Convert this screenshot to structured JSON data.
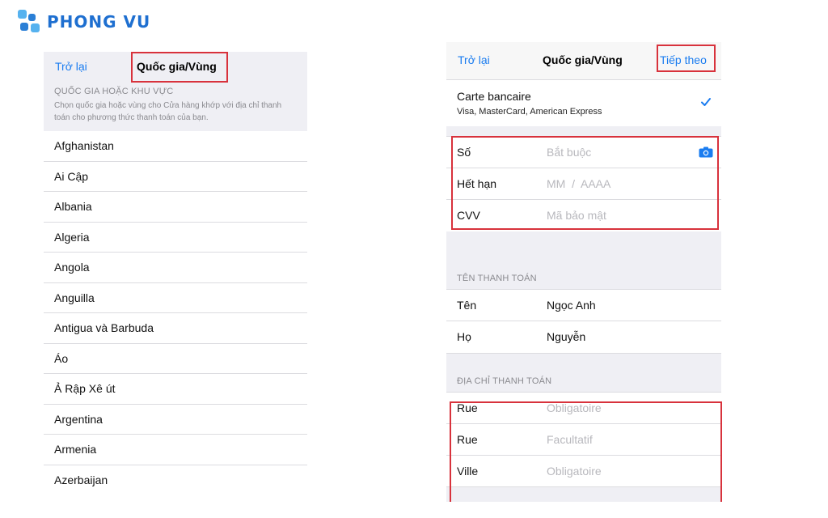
{
  "brand": {
    "name": "PHONG VU"
  },
  "left": {
    "back_label": "Trở lại",
    "title": "Quốc gia/Vùng",
    "section_header": "QUỐC GIA HOẶC KHU VỰC",
    "section_desc": "Chọn quốc gia hoặc vùng cho Cửa hàng khớp với địa chỉ thanh toán cho phương thức thanh toán của bạn.",
    "countries": [
      "Afghanistan",
      "Ai Cập",
      "Albania",
      "Algeria",
      "Angola",
      "Anguilla",
      "Antigua và Barbuda",
      "Áo",
      "Ả Rập Xê út",
      "Argentina",
      "Armenia",
      "Azerbaijan"
    ]
  },
  "right": {
    "back_label": "Trở lại",
    "title": "Quốc gia/Vùng",
    "next_label": "Tiếp theo",
    "card": {
      "title": "Carte bancaire",
      "subtitle": "Visa, MasterCard, American Express"
    },
    "card_fields": {
      "number": {
        "label": "Số",
        "placeholder": "Bắt buộc"
      },
      "expiry": {
        "label": "Hết hạn",
        "placeholder": "MM  /  AAAA"
      },
      "cvv": {
        "label": "CVV",
        "placeholder": "Mã bảo mật"
      }
    },
    "name_header": "TÊN THANH TOÁN",
    "name_fields": {
      "first": {
        "label": "Tên",
        "value": "Ngọc Anh"
      },
      "last": {
        "label": "Họ",
        "value": "Nguyễn"
      }
    },
    "address_header": "ĐỊA CHỈ THANH TOÁN",
    "address_fields": [
      {
        "label": "Rue",
        "placeholder": "Obligatoire"
      },
      {
        "label": "Rue",
        "placeholder": "Facultatif"
      },
      {
        "label": "Ville",
        "placeholder": "Obligatoire"
      }
    ]
  },
  "colors": {
    "accent": "#1a7cf0",
    "highlight": "#d8323c",
    "brand": "#1e6fd0"
  }
}
